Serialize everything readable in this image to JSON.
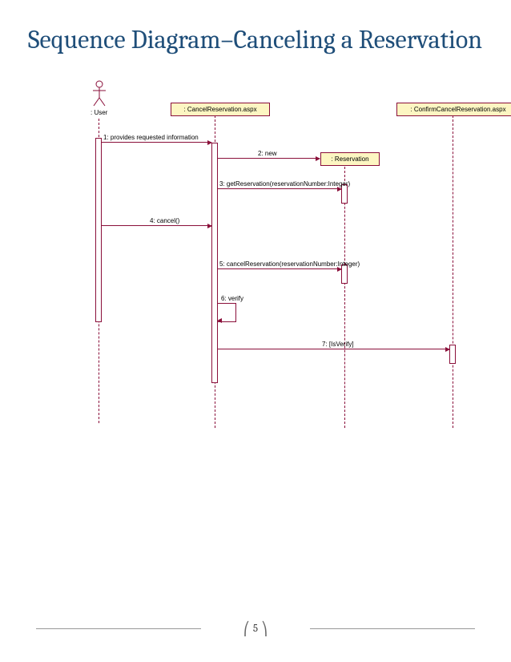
{
  "title": "Sequence Diagram–Canceling a Reservation",
  "page_number": "5",
  "participants": {
    "user": ": User",
    "cancel": ": CancelReservation.aspx",
    "reservation": ": Reservation",
    "confirm": ": ConfirmCancelReservation.aspx"
  },
  "messages": {
    "m1": "1: provides requested information",
    "m2": "2: new",
    "m3": "3: getReservation(reservationNumber:Integer)",
    "m4": "4: cancel()",
    "m5": "5: cancelReservation(reservationNumber:Integer)",
    "m6": "6: verify",
    "m7": "7: [IsVerify]"
  },
  "chart_data": {
    "type": "sequence-diagram",
    "participants": [
      {
        "id": "user",
        "name": ": User",
        "kind": "actor"
      },
      {
        "id": "cancel",
        "name": ": CancelReservation.aspx",
        "kind": "object"
      },
      {
        "id": "reservation",
        "name": ": Reservation",
        "kind": "object",
        "created_by": "m2"
      },
      {
        "id": "confirm",
        "name": ": ConfirmCancelReservation.aspx",
        "kind": "object"
      }
    ],
    "messages": [
      {
        "id": "m1",
        "from": "user",
        "to": "cancel",
        "label": "1: provides requested information"
      },
      {
        "id": "m2",
        "from": "cancel",
        "to": "reservation",
        "label": "2: new",
        "type": "create"
      },
      {
        "id": "m3",
        "from": "cancel",
        "to": "reservation",
        "label": "3: getReservation(reservationNumber:Integer)"
      },
      {
        "id": "m4",
        "from": "user",
        "to": "cancel",
        "label": "4: cancel()"
      },
      {
        "id": "m5",
        "from": "cancel",
        "to": "reservation",
        "label": "5: cancelReservation(reservationNumber:Integer)"
      },
      {
        "id": "m6",
        "from": "cancel",
        "to": "cancel",
        "label": "6: verify",
        "type": "self"
      },
      {
        "id": "m7",
        "from": "cancel",
        "to": "confirm",
        "label": "7: [IsVerify]"
      }
    ]
  }
}
